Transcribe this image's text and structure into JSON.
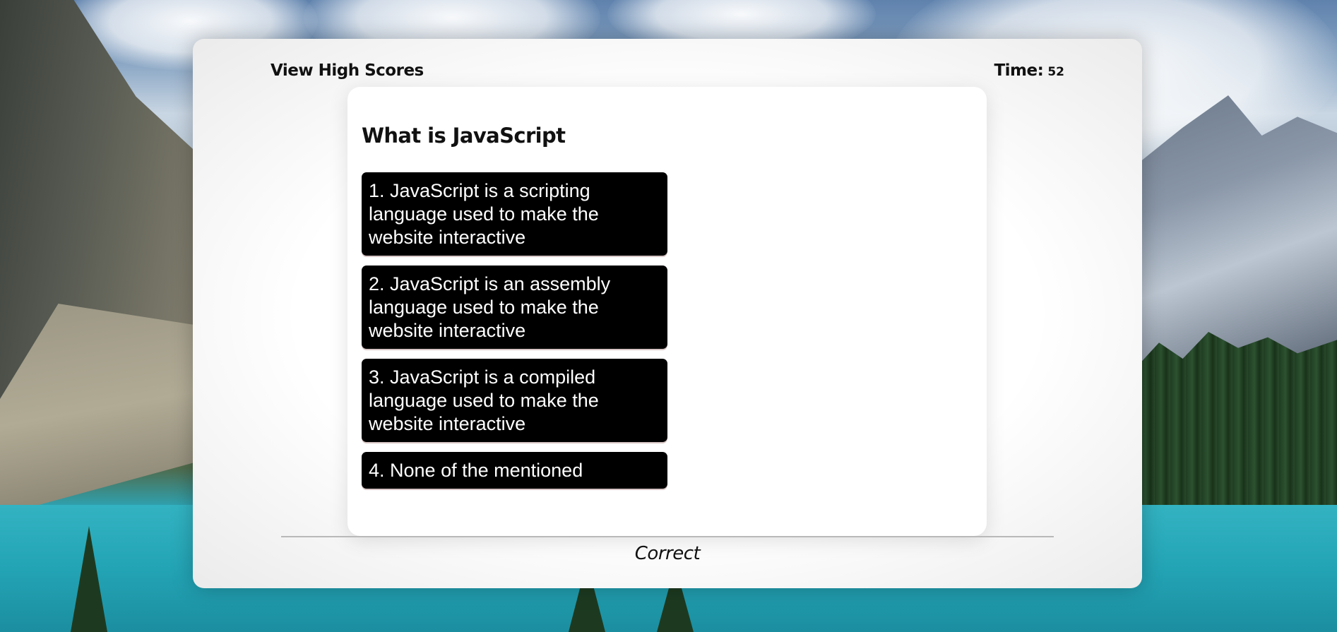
{
  "header": {
    "high_scores_label": "View High Scores",
    "timer_label": "Time:",
    "timer_value": "52"
  },
  "quiz": {
    "question": "What is JavaScript",
    "choices": [
      {
        "label": "1. JavaScript is a scripting language used to make the website interactive"
      },
      {
        "label": "2. JavaScript is an assembly language used to make the website interactive"
      },
      {
        "label": "3. JavaScript is a compiled language used to make the website interactive"
      },
      {
        "label": "4. None of the mentioned"
      }
    ]
  },
  "feedback": {
    "result_text": "Correct"
  },
  "colors": {
    "choice_bg": "#000000",
    "choice_text": "#ffffff",
    "card_bg": "#ffffff"
  }
}
